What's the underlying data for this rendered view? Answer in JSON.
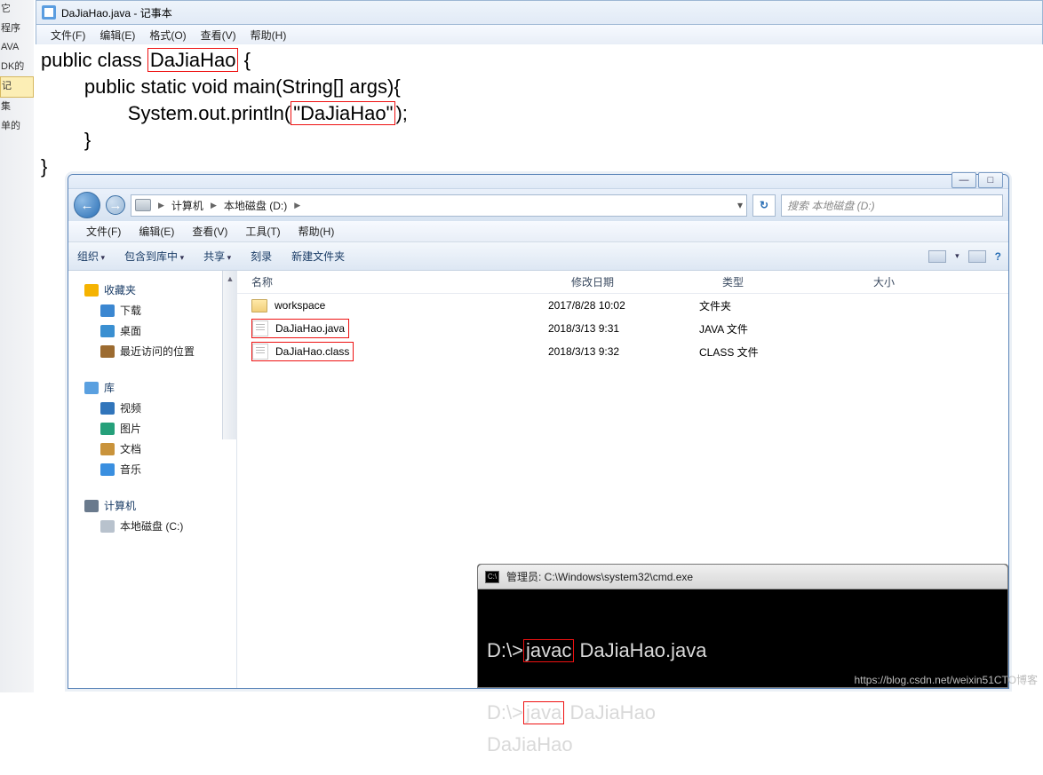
{
  "notepad": {
    "title": "DaJiaHao.java - 记事本",
    "menu": [
      "文件(F)",
      "编辑(E)",
      "格式(O)",
      "查看(V)",
      "帮助(H)"
    ],
    "code": {
      "l1a": "public class ",
      "l1b": "DaJiaHao",
      "l1c": " {",
      "l2": "        public static void main(String[] args){",
      "l3a": "                System.out.println(",
      "l3b": "\"DaJiaHao\"",
      "l3c": ");",
      "l4": "        }",
      "l5": "}"
    }
  },
  "bg_labels": [
    "它",
    "程序",
    "AVA",
    "DK的",
    "记",
    "集",
    "单的"
  ],
  "explorer": {
    "win_buttons": {
      "min": "—",
      "max": "□"
    },
    "breadcrumbs": [
      "计算机",
      "本地磁盘 (D:)"
    ],
    "refresh": "↻",
    "search_placeholder": "搜索 本地磁盘 (D:)",
    "menu": [
      "文件(F)",
      "编辑(E)",
      "查看(V)",
      "工具(T)",
      "帮助(H)"
    ],
    "toolbar": {
      "org": "组织",
      "lib": "包含到库中",
      "share": "共享",
      "burn": "刻录",
      "newf": "新建文件夹",
      "help": "?"
    },
    "nav": {
      "fav": "收藏夹",
      "dl": "下载",
      "desk": "桌面",
      "recent": "最近访问的位置",
      "lib": "库",
      "vid": "视频",
      "pic": "图片",
      "doc": "文档",
      "mus": "音乐",
      "pc": "计算机",
      "hdd": "本地磁盘 (C:)"
    },
    "cols": {
      "name": "名称",
      "date": "修改日期",
      "type": "类型",
      "size": "大小"
    },
    "rows": [
      {
        "name": "workspace",
        "date": "2017/8/28 10:02",
        "type": "文件夹",
        "kind": "folder"
      },
      {
        "name": "DaJiaHao.java",
        "date": "2018/3/13 9:31",
        "type": "JAVA 文件",
        "kind": "file",
        "boxed": true
      },
      {
        "name": "DaJiaHao.class",
        "date": "2018/3/13 9:32",
        "type": "CLASS 文件",
        "kind": "file",
        "boxed": true
      }
    ]
  },
  "cmd": {
    "title": "管理员: C:\\Windows\\system32\\cmd.exe",
    "lines": {
      "p1a": "D:\\>",
      "p1b": "javac",
      "p1c": " DaJiaHao.java",
      "p2a": "D:\\>",
      "p2b": "java",
      "p2c": " DaJiaHao",
      "out": "DaJiaHao"
    }
  },
  "watermark": "https://blog.csdn.net/weixin51CTO博客"
}
